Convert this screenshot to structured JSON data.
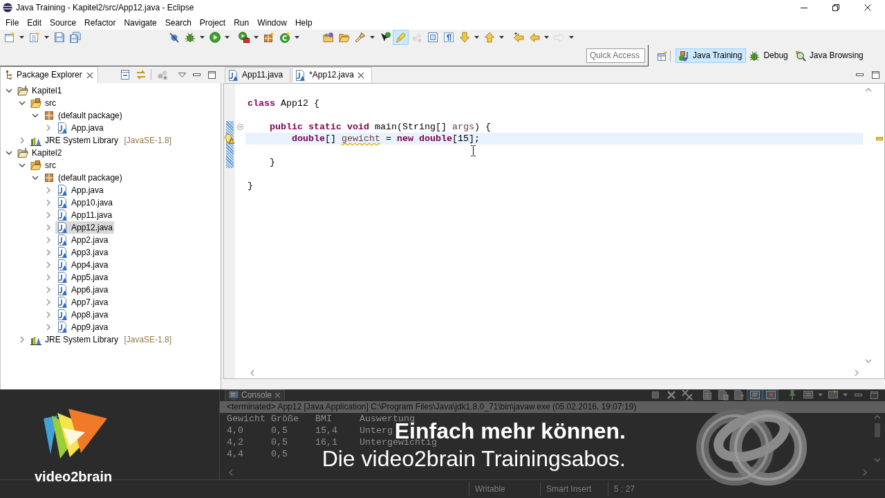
{
  "window": {
    "title": "Java Training - Kapitel2/src/App12.java - Eclipse"
  },
  "menu": [
    "File",
    "Edit",
    "Source",
    "Refactor",
    "Navigate",
    "Search",
    "Project",
    "Run",
    "Window",
    "Help"
  ],
  "toolbar": [
    {
      "selected": false,
      "disabled": false
    },
    {
      "selected": false,
      "disabled": false
    },
    {
      "selected": false,
      "disabled": false
    },
    {
      "selected": false,
      "disabled": false
    },
    {
      "selected": false,
      "disabled": false
    },
    {
      "selected": false,
      "disabled": false
    },
    {
      "selected": false,
      "disabled": false
    },
    {
      "selected": false,
      "disabled": false
    },
    {
      "selected": false,
      "disabled": false
    },
    {
      "selected": false,
      "disabled": false
    },
    {
      "selected": false,
      "disabled": false
    },
    {
      "selected": false,
      "disabled": false
    },
    {
      "selected": false,
      "disabled": false
    },
    {
      "selected": false,
      "disabled": false
    },
    {
      "selected": true,
      "disabled": false
    },
    {
      "selected": false,
      "disabled": true
    },
    {
      "selected": false,
      "disabled": false
    },
    {
      "selected": false,
      "disabled": false
    },
    {
      "selected": false,
      "disabled": false
    },
    {
      "selected": false,
      "disabled": false
    },
    {
      "selected": false,
      "disabled": false
    },
    {
      "selected": false,
      "disabled": false
    },
    {
      "selected": false,
      "disabled": true
    }
  ],
  "quick_access": {
    "placeholder": "Quick Access"
  },
  "perspectives": [
    {
      "label": "Java Training",
      "selected": true
    },
    {
      "label": "Debug",
      "selected": false
    },
    {
      "label": "Java Browsing",
      "selected": false
    }
  ],
  "package_explorer": {
    "title": "Package Explorer",
    "tree": [
      {
        "label": "Kapitel1",
        "kind": "project",
        "expanded": true,
        "selected": false,
        "children": [
          {
            "label": "src",
            "kind": "source_folder",
            "expanded": true,
            "selected": false,
            "children": [
              {
                "label": "(default package)",
                "kind": "package",
                "expanded": true,
                "selected": false,
                "children": [
                  {
                    "label": "App.java",
                    "kind": "file",
                    "expanded": false,
                    "selected": false
                  }
                ]
              }
            ]
          },
          {
            "label": "JRE System Library",
            "decoration": "[JavaSE-1.8]",
            "kind": "library",
            "expanded": false,
            "selected": false
          }
        ]
      },
      {
        "label": "Kapitel2",
        "kind": "project",
        "expanded": true,
        "selected": false,
        "children": [
          {
            "label": "src",
            "kind": "source_folder",
            "expanded": true,
            "selected": false,
            "children": [
              {
                "label": "(default package)",
                "kind": "package",
                "expanded": true,
                "selected": false,
                "children": [
                  {
                    "label": "App.java",
                    "kind": "file",
                    "expanded": false,
                    "selected": false
                  },
                  {
                    "label": "App10.java",
                    "kind": "file",
                    "expanded": false,
                    "selected": false
                  },
                  {
                    "label": "App11.java",
                    "kind": "file",
                    "expanded": false,
                    "selected": false
                  },
                  {
                    "label": "App12.java",
                    "kind": "file",
                    "expanded": false,
                    "selected": true
                  },
                  {
                    "label": "App2.java",
                    "kind": "file",
                    "expanded": false,
                    "selected": false
                  },
                  {
                    "label": "App3.java",
                    "kind": "file",
                    "expanded": false,
                    "selected": false
                  },
                  {
                    "label": "App4.java",
                    "kind": "file",
                    "expanded": false,
                    "selected": false
                  },
                  {
                    "label": "App5.java",
                    "kind": "file",
                    "expanded": false,
                    "selected": false
                  },
                  {
                    "label": "App6.java",
                    "kind": "file",
                    "expanded": false,
                    "selected": false
                  },
                  {
                    "label": "App7.java",
                    "kind": "file",
                    "expanded": false,
                    "selected": false
                  },
                  {
                    "label": "App8.java",
                    "kind": "file",
                    "expanded": false,
                    "selected": false
                  },
                  {
                    "label": "App9.java",
                    "kind": "file",
                    "expanded": false,
                    "selected": false
                  }
                ]
              }
            ]
          },
          {
            "label": "JRE System Library",
            "decoration": "[JavaSE-1.8]",
            "kind": "library",
            "expanded": false,
            "selected": false
          }
        ]
      }
    ]
  },
  "editor": {
    "tabs": [
      {
        "label": "App11.java",
        "selected": false
      },
      {
        "label": "*App12.java",
        "selected": true
      }
    ],
    "lines": [
      {
        "kind": "blank",
        "changed": false,
        "current": false,
        "warning": false
      },
      {
        "kind": "code",
        "changed": false,
        "current": false,
        "warning": false,
        "tokens": [
          {
            "text": "class",
            "kind": "keyword"
          },
          {
            "text": " App12 {",
            "kind": "plain"
          }
        ]
      },
      {
        "kind": "blank",
        "changed": false,
        "current": false,
        "warning": false
      },
      {
        "kind": "code",
        "changed": true,
        "current": false,
        "warning": false,
        "expanded": true,
        "tokens": [
          {
            "text": "    public static void",
            "kind": "keyword"
          },
          {
            "text": " main(String[] ",
            "kind": "plain"
          },
          {
            "text": "args",
            "kind": "variable"
          },
          {
            "text": ") {",
            "kind": "plain"
          }
        ]
      },
      {
        "kind": "code",
        "changed": true,
        "current": true,
        "warning": true,
        "tokens": [
          {
            "text": "        double",
            "kind": "keyword"
          },
          {
            "text": "[] ",
            "kind": "plain"
          },
          {
            "text": "gewicht",
            "kind": "unused"
          },
          {
            "text": " = ",
            "kind": "plain"
          },
          {
            "text": "new double",
            "kind": "keyword"
          },
          {
            "text": "[15];",
            "kind": "plain"
          }
        ]
      },
      {
        "kind": "blank",
        "changed": true,
        "current": false,
        "warning": false
      },
      {
        "kind": "code",
        "changed": true,
        "current": false,
        "warning": false,
        "tokens": [
          {
            "text": "    }",
            "kind": "plain"
          }
        ]
      },
      {
        "kind": "blank",
        "changed": false,
        "current": false,
        "warning": false
      },
      {
        "kind": "code",
        "changed": false,
        "current": false,
        "warning": false,
        "tokens": [
          {
            "text": "}",
            "kind": "plain"
          }
        ]
      }
    ]
  },
  "console": {
    "title": "Console",
    "toolbar": [
      {
        "selected": false
      },
      {
        "selected": false
      },
      {
        "selected": false
      },
      {
        "selected": false
      },
      {
        "selected": false
      },
      {
        "selected": false
      },
      {
        "selected": true
      },
      {
        "selected": true
      },
      {
        "selected": false
      },
      {
        "selected": false
      },
      {
        "selected": false
      }
    ],
    "status": "<terminated> App12 [Java Application] C:\\Program Files\\Java\\jdk1.8.0_71\\bin\\javaw.exe (05.02.2016, 19:07:19)",
    "rows": [
      [
        "Gewicht",
        "Größe",
        "BMI",
        "Auswertung"
      ],
      [
        "4,0",
        "0,5",
        "15,4",
        "Unterg"
      ],
      [
        "4,2",
        "0,5",
        "16,1",
        "Untergewichtig"
      ],
      [
        "4,4",
        "0,5"
      ]
    ]
  },
  "status_bar": [
    "Writable",
    "Smart Insert",
    "5 : 27"
  ],
  "promo_banner": {
    "brand": "video2brain",
    "headline": "Einfach mehr können.",
    "tagline": "Die video2brain Trainingsabos."
  }
}
